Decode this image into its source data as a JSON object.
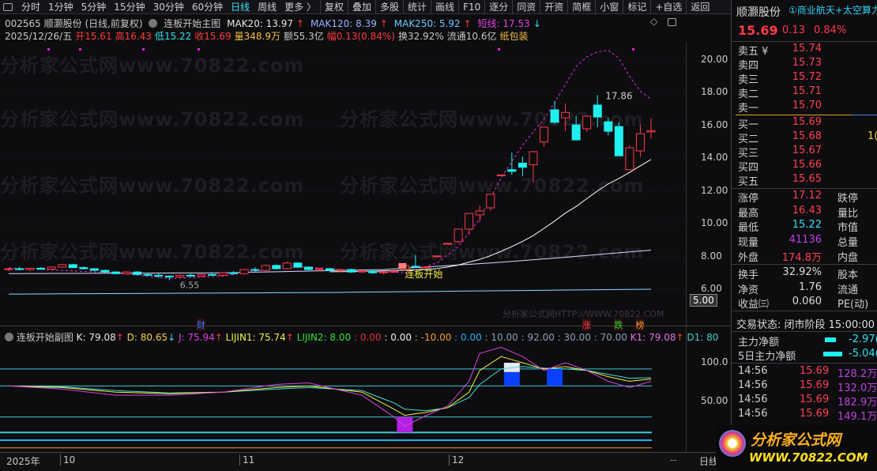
{
  "toolbar": {
    "items": [
      "分时",
      "1分钟",
      "5分钟",
      "15分钟",
      "30分钟",
      "60分钟",
      "日线",
      "周线",
      "更多 〉"
    ],
    "active": "日线",
    "buttons": [
      "复权",
      "叠加",
      "多股",
      "统计",
      "画线",
      "F10",
      "逐分",
      "同资",
      "开资",
      "简框",
      "小窗",
      "标记",
      "+自选",
      "返回"
    ]
  },
  "header": {
    "code_name": "002565 顺灏股份 (日线,前复权)",
    "indicator": "连板开始主图",
    "mak20": "MAK20: 13.97",
    "mak120": "MAK120: 8.39",
    "mak250": "MAK250: 5.92",
    "short": "短线: 17.53",
    "arrow_up": "↑",
    "arrow_down": "↓"
  },
  "quote": {
    "date": "2025/12/26/五",
    "open": "开15.61",
    "high": "高16.43",
    "low": "低15.22",
    "close": "收15.69",
    "vol": "量348.9万",
    "amount": "额55.3亿",
    "change": "幅0.13(0.84%)",
    "turnover": "换32.92%",
    "float": "流通10.6亿",
    "sector": "纸包装"
  },
  "chart": {
    "price_ticks": [
      "20.00",
      "18.00",
      "16.00",
      "14.00",
      "12.00",
      "10.00",
      "8.00",
      "6.00"
    ],
    "price_values": [
      20,
      18,
      16,
      14,
      12,
      10,
      8,
      6
    ],
    "axis_box": "5.00",
    "high_label": "17.86",
    "low_label": "6.55",
    "signal_label": "连板开始",
    "markers": [
      {
        "text": "财",
        "color": "#3a7bff",
        "index": 18
      },
      {
        "text": "涨",
        "color": "#ff4040",
        "index": 54
      },
      {
        "text": "跌",
        "color": "#33dd33",
        "index": 57
      },
      {
        "text": "榜",
        "color": "#ff9933",
        "index": 59
      }
    ],
    "watermark": "分析家公式网www.70822.com",
    "watermark_small": "分析家公式网HTTP://WWW.70822.COM",
    "candles": [
      [
        7.2,
        7.3,
        7.1,
        7.25
      ],
      [
        7.25,
        7.35,
        7.15,
        7.2
      ],
      [
        7.2,
        7.3,
        7.1,
        7.28
      ],
      [
        7.28,
        7.35,
        7.2,
        7.22
      ],
      [
        7.22,
        7.4,
        7.2,
        7.35
      ],
      [
        7.35,
        7.55,
        7.3,
        7.5
      ],
      [
        7.5,
        7.55,
        7.3,
        7.32
      ],
      [
        7.32,
        7.4,
        7.2,
        7.25
      ],
      [
        7.25,
        7.3,
        7.1,
        7.15
      ],
      [
        7.15,
        7.2,
        7.0,
        7.05
      ],
      [
        7.05,
        7.1,
        6.9,
        6.95
      ],
      [
        6.95,
        7.1,
        6.9,
        7.05
      ],
      [
        7.05,
        7.1,
        6.85,
        6.9
      ],
      [
        6.9,
        7.0,
        6.8,
        6.85
      ],
      [
        6.85,
        6.95,
        6.7,
        6.8
      ],
      [
        6.8,
        6.85,
        6.55,
        6.75
      ],
      [
        6.75,
        6.9,
        6.7,
        6.85
      ],
      [
        6.85,
        6.95,
        6.75,
        6.8
      ],
      [
        6.8,
        6.95,
        6.75,
        6.9
      ],
      [
        6.9,
        7.0,
        6.8,
        6.85
      ],
      [
        6.85,
        7.05,
        6.8,
        7.0
      ],
      [
        7.0,
        7.1,
        6.9,
        6.95
      ],
      [
        6.95,
        7.25,
        6.9,
        7.2
      ],
      [
        7.2,
        7.35,
        7.1,
        7.15
      ],
      [
        7.15,
        7.5,
        7.1,
        7.45
      ],
      [
        7.45,
        7.5,
        7.2,
        7.25
      ],
      [
        7.25,
        7.7,
        7.2,
        7.6
      ],
      [
        7.6,
        7.65,
        7.3,
        7.35
      ],
      [
        7.35,
        7.4,
        7.15,
        7.2
      ],
      [
        7.2,
        7.3,
        7.1,
        7.25
      ],
      [
        7.25,
        7.3,
        7.1,
        7.15
      ],
      [
        7.15,
        7.25,
        7.05,
        7.2
      ],
      [
        7.2,
        7.25,
        7.0,
        7.05
      ],
      [
        7.05,
        7.15,
        7.0,
        7.1
      ],
      [
        7.1,
        7.2,
        6.95,
        7.0
      ],
      [
        7.0,
        7.1,
        6.9,
        7.05
      ],
      [
        7.05,
        7.2,
        7.0,
        7.1
      ],
      [
        7.2,
        7.6,
        7.15,
        7.45
      ],
      [
        7.4,
        8.1,
        7.3,
        7.35
      ],
      [
        7.3,
        7.4,
        7.25,
        7.35
      ],
      [
        8.03,
        8.03,
        8.03,
        8.03
      ],
      [
        8.8,
        8.8,
        8.8,
        8.8
      ],
      [
        8.9,
        9.67,
        8.8,
        9.67
      ],
      [
        9.67,
        10.63,
        9.33,
        10.63
      ],
      [
        10.54,
        11.1,
        10.1,
        10.78
      ],
      [
        10.97,
        11.8,
        10.8,
        11.8
      ],
      [
        12.98,
        12.98,
        12.98,
        12.98
      ],
      [
        13.3,
        14.35,
        13.0,
        13.2
      ],
      [
        13.7,
        14.1,
        12.9,
        13.45
      ],
      [
        13.6,
        14.45,
        12.5,
        14.4
      ],
      [
        15.0,
        15.9,
        14.7,
        15.9
      ],
      [
        16.96,
        17.5,
        16.1,
        16.2
      ],
      [
        16.47,
        17.35,
        15.65,
        16.8
      ],
      [
        16.04,
        16.6,
        15.12,
        15.12
      ],
      [
        15.8,
        16.6,
        15.6,
        16.57
      ],
      [
        17.25,
        17.86,
        15.9,
        16.52
      ],
      [
        16.23,
        16.5,
        15.4,
        15.65
      ],
      [
        15.94,
        16.2,
        14.15,
        14.15
      ],
      [
        13.3,
        14.8,
        13.3,
        14.64
      ],
      [
        14.45,
        16.05,
        14.1,
        15.5
      ],
      [
        15.61,
        16.43,
        15.22,
        15.69
      ]
    ],
    "short_line": [
      [
        0,
        7.3
      ],
      [
        10,
        7.0
      ],
      [
        15,
        6.65
      ],
      [
        20,
        6.8
      ],
      [
        25,
        7.3
      ],
      [
        28,
        7.35
      ],
      [
        33,
        7.1
      ],
      [
        37,
        7.0
      ],
      [
        40,
        7.6
      ],
      [
        42,
        8.6
      ],
      [
        44,
        10.3
      ],
      [
        46,
        12.8
      ],
      [
        48,
        14.8
      ],
      [
        50,
        16.4
      ],
      [
        51,
        17.4
      ],
      [
        52,
        18.5
      ],
      [
        53,
        19.6
      ],
      [
        54,
        20.2
      ],
      [
        55,
        20.5
      ],
      [
        56,
        20.6
      ],
      [
        57,
        20.1
      ],
      [
        58,
        19.0
      ],
      [
        59,
        18.1
      ],
      [
        60,
        17.6
      ]
    ],
    "ma120": [
      [
        0,
        6.95
      ],
      [
        20,
        7.0
      ],
      [
        35,
        7.2
      ],
      [
        45,
        7.6
      ],
      [
        52,
        7.95
      ],
      [
        60,
        8.39
      ]
    ],
    "ma250": [
      [
        0,
        5.7
      ],
      [
        30,
        5.8
      ],
      [
        60,
        6.0
      ]
    ],
    "sub": {
      "title": "连板开始副图",
      "k": "K: 79.08",
      "d": "D: 80.65",
      "j": "J: 75.94",
      "lijin1": "LIJIN1: 75.74",
      "lijin2": "LIJIN2: 8.00",
      "c1": ": 0.00",
      "c2": ": 0.00",
      "c3": ": -10.00",
      "c4": ": 0.00",
      "c5": ": 10.00",
      "c6": ": 92.00",
      "c7": ": 30.00",
      "c8": ": 70.00",
      "k1": "K1: 79.08",
      "d1": "D1: 80",
      "ticks": [
        "100.0",
        "50.00"
      ],
      "tick_values": [
        100,
        50
      ],
      "levels": [
        92,
        70,
        30,
        10,
        0,
        -10
      ],
      "K": [
        [
          0,
          70
        ],
        [
          5,
          68
        ],
        [
          10,
          62
        ],
        [
          15,
          60
        ],
        [
          20,
          62
        ],
        [
          25,
          68
        ],
        [
          28,
          70
        ],
        [
          33,
          62
        ],
        [
          36,
          40
        ],
        [
          37,
          32
        ],
        [
          39,
          36
        ],
        [
          41,
          42
        ],
        [
          43,
          62
        ],
        [
          44,
          90
        ],
        [
          46,
          108
        ],
        [
          48,
          100
        ],
        [
          50,
          92
        ],
        [
          52,
          95
        ],
        [
          54,
          90
        ],
        [
          56,
          82
        ],
        [
          58,
          76
        ],
        [
          60,
          79
        ]
      ],
      "D": [
        [
          0,
          70
        ],
        [
          5,
          69
        ],
        [
          10,
          64
        ],
        [
          15,
          61
        ],
        [
          20,
          62
        ],
        [
          25,
          66
        ],
        [
          28,
          68
        ],
        [
          33,
          64
        ],
        [
          36,
          48
        ],
        [
          37,
          40
        ],
        [
          39,
          38
        ],
        [
          41,
          42
        ],
        [
          43,
          55
        ],
        [
          44,
          72
        ],
        [
          46,
          92
        ],
        [
          48,
          95
        ],
        [
          50,
          93
        ],
        [
          52,
          92
        ],
        [
          54,
          90
        ],
        [
          56,
          85
        ],
        [
          58,
          80
        ],
        [
          60,
          80.65
        ]
      ],
      "J": [
        [
          0,
          70
        ],
        [
          5,
          66
        ],
        [
          10,
          58
        ],
        [
          15,
          58
        ],
        [
          20,
          62
        ],
        [
          25,
          72
        ],
        [
          28,
          74
        ],
        [
          33,
          58
        ],
        [
          36,
          30
        ],
        [
          37,
          18
        ],
        [
          39,
          32
        ],
        [
          41,
          44
        ],
        [
          43,
          76
        ],
        [
          44,
          112
        ],
        [
          46,
          120
        ],
        [
          48,
          108
        ],
        [
          50,
          90
        ],
        [
          52,
          100
        ],
        [
          54,
          90
        ],
        [
          56,
          76
        ],
        [
          58,
          68
        ],
        [
          60,
          75.94
        ]
      ],
      "bars": [
        {
          "index": 37,
          "from": 10,
          "to": 30,
          "color": "#b020e0"
        },
        {
          "index": 47,
          "from": 70,
          "to": 88,
          "color": "#0a40ff"
        },
        {
          "index": 47,
          "from": 88,
          "to": 100,
          "color": "#e8e8f0"
        },
        {
          "index": 51,
          "from": 70,
          "to": 92,
          "color": "#0a40ff"
        }
      ]
    }
  },
  "dates": {
    "year": "2025年",
    "m10": "10",
    "m11": "11",
    "m12": "12",
    "scroll": "--",
    "period": "日线"
  },
  "right": {
    "name": "顺灏股份",
    "concept": "①商业航天+太空算力",
    "price": "15.69",
    "chg": "0.13",
    "pct": "0.84%",
    "asks": [
      {
        "l": "卖五 ¥",
        "v": "15.74"
      },
      {
        "l": "卖四",
        "v": "15.73"
      },
      {
        "l": "卖三",
        "v": "15.72"
      },
      {
        "l": "卖二",
        "v": "15.71"
      },
      {
        "l": "卖一",
        "v": "15.70"
      }
    ],
    "bids": [
      {
        "l": "买一",
        "v": "15.69"
      },
      {
        "l": "买二",
        "v": "15.68"
      },
      {
        "l": "买三",
        "v": "15.67"
      },
      {
        "l": "买四",
        "v": "15.66"
      },
      {
        "l": "买五",
        "v": "15.65"
      }
    ],
    "bid2_vol": "1(",
    "stats": [
      {
        "l": "涨停",
        "v": "17.12",
        "c": "#ff4050",
        "l2": "跌停"
      },
      {
        "l": "最高",
        "v": "16.43",
        "c": "#ff4050",
        "l2": "量比"
      },
      {
        "l": "最低",
        "v": "15.22",
        "c": "#33e0f0",
        "l2": "市值"
      },
      {
        "l": "现量",
        "v": "41136",
        "c": "#c040e0",
        "l2": "总量"
      },
      {
        "l": "外盘",
        "v": "174.8万",
        "c": "#ff4050",
        "l2": "内盘"
      }
    ],
    "stats2": [
      {
        "l": "换手",
        "v": "32.92%",
        "l2": "股本"
      },
      {
        "l": "净资",
        "v": "1.76",
        "l2": "流通"
      },
      {
        "l": "收益㈢",
        "v": "0.060",
        "l2": "PE(动)"
      }
    ],
    "status": "交易状态: 闭市阶段 15:00:00",
    "flow": [
      {
        "l": "主力净额",
        "v": "-2.97("
      },
      {
        "l": "5日主力净额",
        "v": "-5.04("
      }
    ],
    "trades": [
      {
        "t": "14:56",
        "p": "15.69",
        "v": "128.2万"
      },
      {
        "t": "14:56",
        "p": "15.69",
        "v": "132.0万"
      },
      {
        "t": "14:56",
        "p": "15.69",
        "v": "182.9万"
      },
      {
        "t": "14:56",
        "p": "15.69",
        "v": "149.1万"
      }
    ],
    "logo": "分析家公式网",
    "logo_url": "WWW.70822.COM"
  }
}
